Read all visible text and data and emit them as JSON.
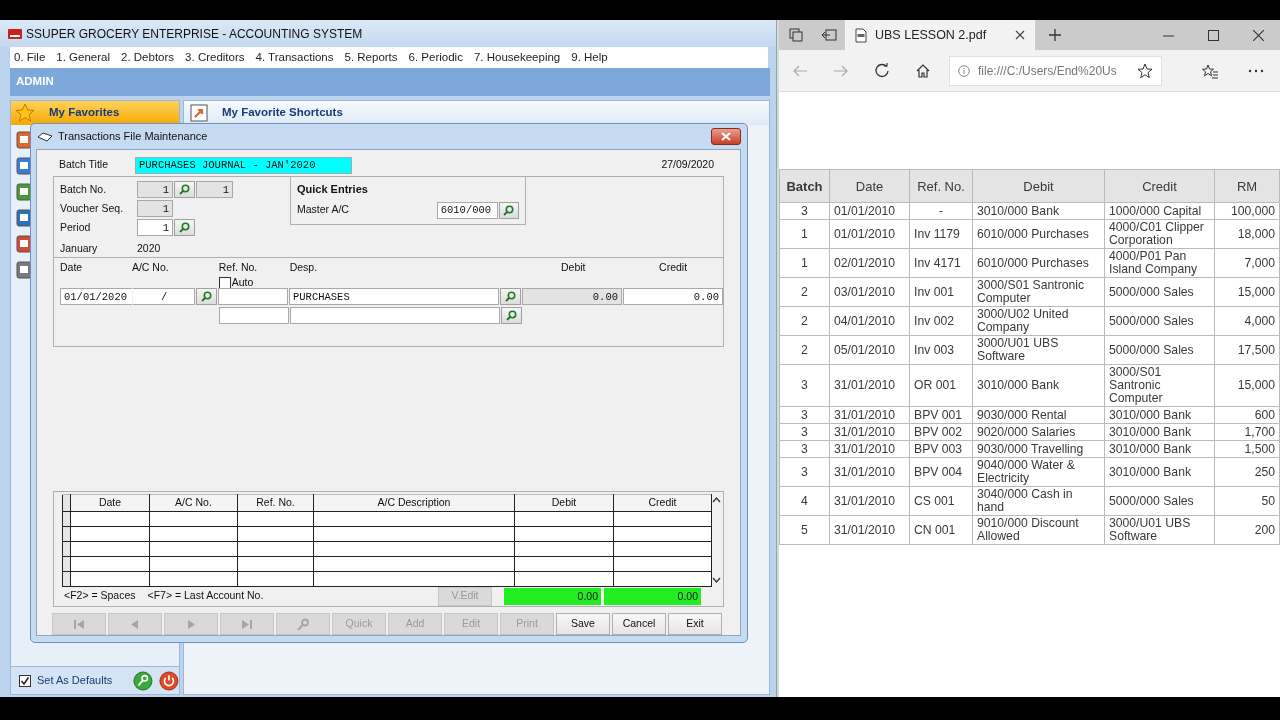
{
  "app": {
    "title": "SSUPER GROCERY ENTERPRISE - ACCOUNTING SYSTEM",
    "menu": [
      "0. File",
      "1. General",
      "2. Debtors",
      "3. Creditors",
      "4. Transactions",
      "5. Reports",
      "6. Periodic",
      "7. Housekeeping",
      "9. Help"
    ],
    "user_bar": "ADMIN",
    "favorites_title": "My Favorites",
    "shortcuts_title": "My Favorite Shortcuts",
    "set_as_defaults": {
      "label": "Set As Defaults",
      "checked": true
    }
  },
  "dialog": {
    "title": "Transactions File Maintenance",
    "batch_title": {
      "label": "Batch Title",
      "value": "PURCHASES JOURNAL - JAN'2020"
    },
    "date": "27/09/2020",
    "fields": [
      {
        "label": "Batch No.",
        "value": "1",
        "disabled": true,
        "lookup": true,
        "extra": "1"
      },
      {
        "label": "Voucher Seq.",
        "value": "1",
        "disabled": true,
        "lookup": false
      },
      {
        "label": "Period",
        "value": "1",
        "disabled": false,
        "lookup": true
      }
    ],
    "month": "January",
    "year": "2020",
    "quick_entries": {
      "title": "Quick Entries",
      "master_ac_label": "Master A/C",
      "master_ac": "6010/000"
    },
    "entry": {
      "columns": [
        "Date",
        "A/C No.",
        "Ref. No.",
        "Desp.",
        "Debit",
        "Credit"
      ],
      "auto": {
        "label": "Auto",
        "checked": false
      },
      "date": "01/01/2020",
      "ac_no": "/",
      "desp": "PURCHASES",
      "debit": "0.00",
      "credit": "0.00"
    },
    "grid": {
      "columns": [
        "Date",
        "A/C No.",
        "Ref. No.",
        "A/C Description",
        "Debit",
        "Credit"
      ]
    },
    "hints": [
      "<F2> = Spaces",
      "<F7> = Last Account No."
    ],
    "v_edit": {
      "label": "V.Edit",
      "disabled": true
    },
    "total_debit": "0.00",
    "total_credit": "0.00",
    "nav_buttons": [
      {
        "kind": "first",
        "disabled": true
      },
      {
        "kind": "prev",
        "disabled": true
      },
      {
        "kind": "next",
        "disabled": true
      },
      {
        "kind": "last",
        "disabled": true
      },
      {
        "kind": "find",
        "disabled": true
      }
    ],
    "buttons": [
      {
        "label": "Quick",
        "disabled": true
      },
      {
        "label": "Add",
        "disabled": true
      },
      {
        "label": "Edit",
        "disabled": true
      },
      {
        "label": "Print",
        "disabled": true
      },
      {
        "label": "Save",
        "disabled": false
      },
      {
        "label": "Cancel",
        "disabled": false
      },
      {
        "label": "Exit",
        "disabled": false
      }
    ]
  },
  "browser": {
    "tab_title": "UBS LESSON 2.pdf",
    "address": "file:///C:/Users/End%20Us",
    "table": {
      "columns": [
        "Batch",
        "Date",
        "Ref. No.",
        "Debit",
        "Credit",
        "RM"
      ],
      "rows": [
        [
          "3",
          "01/01/2010",
          "-",
          "3010/000 Bank",
          "1000/000 Capital",
          "100,000"
        ],
        [
          "1",
          "01/01/2010",
          "Inv 1179",
          "6010/000 Purchases",
          "4000/C01 Clipper Corporation",
          "18,000"
        ],
        [
          "1",
          "02/01/2010",
          "Inv 4171",
          "6010/000 Purchases",
          "4000/P01 Pan Island Company",
          "7,000"
        ],
        [
          "2",
          "03/01/2010",
          "Inv 001",
          "3000/S01 Santronic Computer",
          "5000/000 Sales",
          "15,000"
        ],
        [
          "2",
          "04/01/2010",
          "Inv 002",
          "3000/U02 United Company",
          "5000/000 Sales",
          "4,000"
        ],
        [
          "2",
          "05/01/2010",
          "Inv 003",
          "3000/U01 UBS Software",
          "5000/000 Sales",
          "17,500"
        ],
        [
          "3",
          "31/01/2010",
          "OR 001",
          "3010/000 Bank",
          "3000/S01 Santronic Computer",
          "15,000"
        ],
        [
          "3",
          "31/01/2010",
          "BPV 001",
          "9030/000 Rental",
          "3010/000 Bank",
          "600"
        ],
        [
          "3",
          "31/01/2010",
          "BPV 002",
          "9020/000 Salaries",
          "3010/000 Bank",
          "1,700"
        ],
        [
          "3",
          "31/01/2010",
          "BPV 003",
          "9030/000 Travelling",
          "3010/000 Bank",
          "1,500"
        ],
        [
          "3",
          "31/01/2010",
          "BPV 004",
          "9040/000 Water & Electricity",
          "3010/000 Bank",
          "250"
        ],
        [
          "4",
          "31/01/2010",
          "CS 001",
          "3040/000 Cash in hand",
          "5000/000 Sales",
          "50"
        ],
        [
          "5",
          "31/01/2010",
          "CN 001",
          "9010/000 Discount Allowed",
          "3000/U01 UBS Software",
          "200"
        ]
      ]
    }
  }
}
